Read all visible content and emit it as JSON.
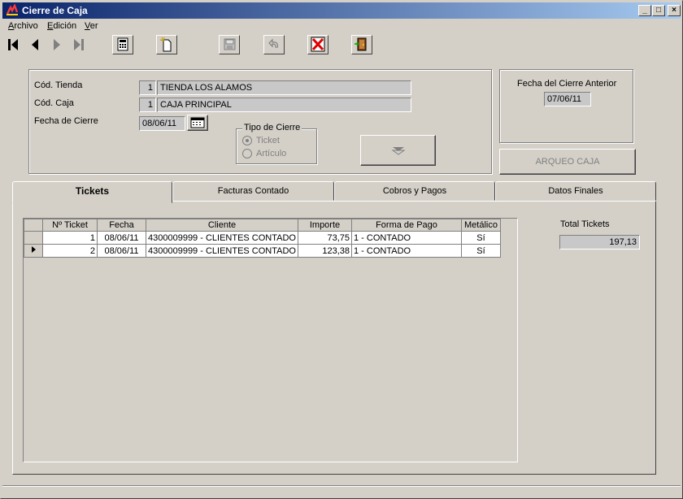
{
  "window": {
    "title": "Cierre de Caja",
    "title_buttons": {
      "minimize": "_",
      "maximize": "□",
      "close": "×"
    }
  },
  "menu": [
    {
      "label": "Archivo",
      "accel": "A",
      "rest": "rchivo"
    },
    {
      "label": "Edición",
      "accel": "E",
      "rest": "dición"
    },
    {
      "label": "Ver",
      "accel": "V",
      "rest": "er"
    }
  ],
  "toolbar": {
    "icons": [
      "first-record-icon",
      "previous-record-icon",
      "next-record-icon",
      "last-record-icon",
      "calculator-icon",
      "new-document-icon",
      "save-icon",
      "undo-icon",
      "delete-icon",
      "exit-door-icon"
    ]
  },
  "header": {
    "cod_tienda_label": "Cód. Tienda",
    "cod_tienda_num": "1",
    "cod_tienda_name": "TIENDA LOS ALAMOS",
    "cod_caja_label": "Cód. Caja",
    "cod_caja_num": "1",
    "cod_caja_name": "CAJA PRINCIPAL",
    "fecha_cierre_label": "Fecha de Cierre",
    "fecha_cierre": "08/06/11",
    "tipo_cierre_label": "Tipo de Cierre",
    "tipo_ticket": "Ticket",
    "tipo_articulo": "Artículo",
    "fecha_anterior_label": "Fecha del Cierre Anterior",
    "fecha_anterior": "07/06/11",
    "arqueo_label": "ARQUEO CAJA"
  },
  "tabs": [
    "Tickets",
    "Facturas Contado",
    "Cobros y Pagos",
    "Datos Finales"
  ],
  "tickets": {
    "columns": [
      "Nº Ticket",
      "Fecha",
      "Cliente",
      "Importe",
      "Forma de Pago",
      "Metálico"
    ],
    "rows": [
      {
        "numero": "1",
        "fecha": "08/06/11",
        "cliente": "4300009999 - CLIENTES CONTADO",
        "importe": "73,75",
        "forma_pago": "1 - CONTADO",
        "metalico": "Sí"
      },
      {
        "numero": "2",
        "fecha": "08/06/11",
        "cliente": "4300009999 - CLIENTES CONTADO",
        "importe": "123,38",
        "forma_pago": "1 - CONTADO",
        "metalico": "Sí"
      }
    ],
    "total_label": "Total Tickets",
    "total_value": "197,13"
  }
}
